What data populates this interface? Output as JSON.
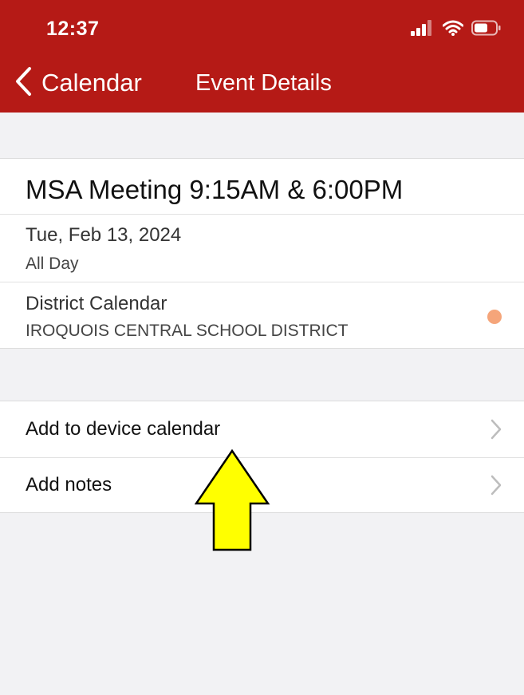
{
  "status_bar": {
    "time": "12:37",
    "icons": [
      "signal-icon",
      "wifi-icon",
      "battery-icon"
    ]
  },
  "nav": {
    "back_label": "Calendar",
    "title": "Event Details"
  },
  "event": {
    "title": "MSA Meeting 9:15AM & 6:00PM",
    "date": "Tue, Feb 13, 2024",
    "time_label": "All Day",
    "calendar_name": "District Calendar",
    "organization": "IROQUOIS CENTRAL SCHOOL DISTRICT",
    "calendar_color": "#f5a57a"
  },
  "actions": [
    {
      "label": "Add to device calendar"
    },
    {
      "label": "Add notes"
    }
  ],
  "colors": {
    "header": "#b51a16",
    "background": "#f2f2f4",
    "annotation_arrow": "#ffff00"
  }
}
